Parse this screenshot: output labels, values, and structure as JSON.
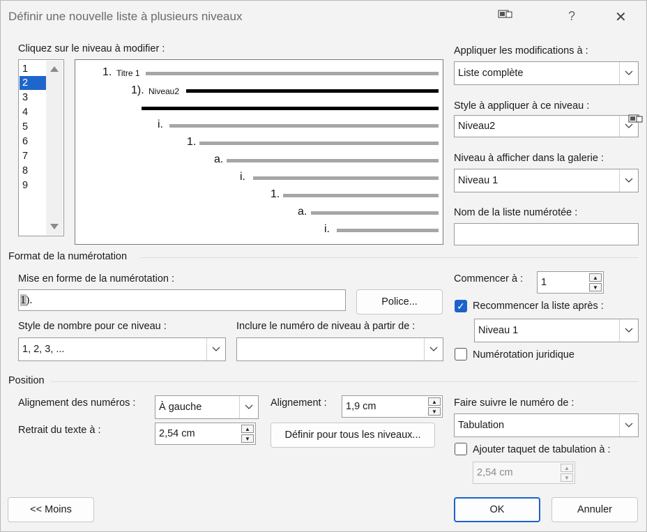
{
  "dialog": {
    "title": "Définir une nouvelle liste à plusieurs niveaux",
    "help_glyph": "?",
    "close_glyph": "✕"
  },
  "levels": {
    "label": "Cliquez sur le niveau à modifier :",
    "items": [
      "1",
      "2",
      "3",
      "4",
      "5",
      "6",
      "7",
      "8",
      "9"
    ],
    "selected": "2"
  },
  "preview": {
    "lines": [
      {
        "number": "1.",
        "text": "Titre 1"
      },
      {
        "number": "1).",
        "text": "Niveau2"
      },
      {
        "number": "",
        "text": ""
      },
      {
        "number": "i.",
        "text": ""
      },
      {
        "number": "1.",
        "text": ""
      },
      {
        "number": "a.",
        "text": ""
      },
      {
        "number": "i.",
        "text": ""
      },
      {
        "number": "1.",
        "text": ""
      },
      {
        "number": "a.",
        "text": ""
      },
      {
        "number": "i.",
        "text": ""
      }
    ]
  },
  "right_panel": {
    "apply_label": "Appliquer les modifications à :",
    "apply_value": "Liste complète",
    "style_label": "Style à appliquer à ce niveau :",
    "style_value": "Niveau2",
    "gallery_label": "Niveau à afficher dans la galerie :",
    "gallery_value": "Niveau 1",
    "listname_label": "Nom de la liste numérotée :",
    "listname_value": ""
  },
  "format": {
    "section_title": "Format de la numérotation",
    "mask_label": "Mise en forme de la numérotation :",
    "mask_value": "1).",
    "police_button": "Police...",
    "numstyle_label": "Style de nombre pour ce niveau :",
    "numstyle_value": "1, 2, 3, ...",
    "include_label": "Inclure le numéro de niveau à partir de :",
    "include_value": "",
    "start_label": "Commencer à :",
    "start_value": "1",
    "restart_label": "Recommencer la liste après :",
    "restart_checked": true,
    "restart_value": "Niveau 1",
    "legal_label": "Numérotation juridique",
    "legal_checked": false
  },
  "position": {
    "section_title": "Position",
    "align_label": "Alignement des numéros :",
    "align_value": "À gauche",
    "alignment_label": "Alignement :",
    "alignment_value": "1,9 cm",
    "indent_label": "Retrait du texte à :",
    "indent_value": "2,54 cm",
    "all_levels_button": "Définir pour tous les niveaux...",
    "follow_label": "Faire suivre le numéro de :",
    "follow_value": "Tabulation",
    "tabstop_label": "Ajouter taquet de tabulation à :",
    "tabstop_checked": false,
    "tabstop_value": "2,54 cm"
  },
  "footer": {
    "less_button": "<< Moins",
    "ok_button": "OK",
    "cancel_button": "Annuler"
  }
}
